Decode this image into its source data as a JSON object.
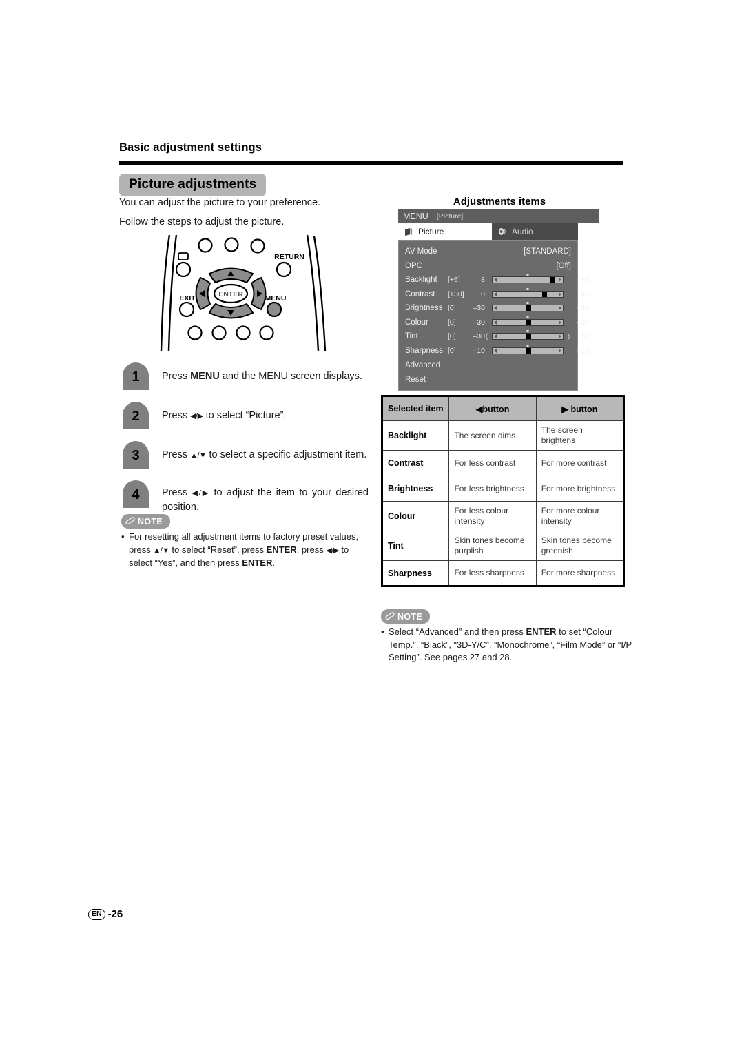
{
  "header": {
    "section_title": "Basic adjustment settings",
    "chapter_title": "Picture adjustments",
    "intro_1": "You can adjust the picture to your preference.",
    "intro_2": "Follow the steps to adjust the picture."
  },
  "remote": {
    "labels": {
      "return": "RETURN",
      "exit": "EXIT",
      "menu": "MENU",
      "enter": "ENTER",
      "up": "▲",
      "down": "▼",
      "left": "◀",
      "right": "▶"
    }
  },
  "steps": [
    {
      "number": "1",
      "text_html": "Press <b class=\"k\">MENU</b> and the MENU screen displays."
    },
    {
      "number": "2",
      "text_html": "Press <span class=\"arrows\">◀/▶</span> to select “Picture”."
    },
    {
      "number": "3",
      "text_html": "Press <span class=\"arrows\">▲/▼</span> to select a specific adjustment item."
    },
    {
      "number": "4",
      "text_html": "Press <span class=\"arrows\">◀/▶</span> to adjust the item to your desired position."
    }
  ],
  "note_left": {
    "badge": "NOTE",
    "icon": "pencil-icon",
    "text_html": "For resetting all adjustment items to factory preset values, press <span class=\"arrows\">▲/▼</span> to select “Reset”, press <b class=\"k\">ENTER</b>, press <span class=\"arrows\">◀/▶</span> to select “Yes”, and then press <b class=\"k\">ENTER</b>."
  },
  "note_right": {
    "badge": "NOTE",
    "icon": "pencil-icon",
    "text_html": "Select “Advanced” and then press <b class=\"k\">ENTER</b> to set “Colour Temp.”, “Black”, “3D-Y/C”, “Monochrome”, “Film Mode” or “I/P Setting”. See pages 27 and 28."
  },
  "osd": {
    "caption": "Adjustments items",
    "titlebar_main": "MENU",
    "titlebar_sub": "[Picture]",
    "tabs": [
      {
        "label": "Picture",
        "icon": "picture-icon",
        "active": true
      },
      {
        "label": "Audio",
        "icon": "speaker-icon",
        "active": false
      }
    ],
    "rows": [
      {
        "type": "value",
        "name": "AV Mode",
        "value": "[STANDARD]"
      },
      {
        "type": "value",
        "name": "OPC",
        "value": "[Off]"
      },
      {
        "type": "slider",
        "name": "Backlight",
        "current": "[+6]",
        "min": "–8",
        "max": "+8",
        "knob_pct": 87.5,
        "brackets": false
      },
      {
        "type": "slider",
        "name": "Contrast",
        "current": "[+30]",
        "min": "0",
        "max": "+40",
        "knob_pct": 75.0,
        "brackets": false
      },
      {
        "type": "slider",
        "name": "Brightness",
        "current": "[0]",
        "min": "–30",
        "max": "+30",
        "knob_pct": 50.0,
        "brackets": false
      },
      {
        "type": "slider",
        "name": "Colour",
        "current": "[0]",
        "min": "–30",
        "max": "+30",
        "knob_pct": 50.0,
        "brackets": false
      },
      {
        "type": "slider",
        "name": "Tint",
        "current": "[0]",
        "min": "–30",
        "max": "+30",
        "knob_pct": 50.0,
        "brackets": true
      },
      {
        "type": "slider",
        "name": "Sharpness",
        "current": "[0]",
        "min": "–10",
        "max": "+10",
        "knob_pct": 50.0,
        "brackets": false
      },
      {
        "type": "plain",
        "name": "Advanced"
      },
      {
        "type": "plain",
        "name": "Reset"
      }
    ]
  },
  "table": {
    "headers": [
      "Selected item",
      "◀button",
      "▶ button"
    ],
    "rows": [
      {
        "item": "Backlight",
        "left": "The screen dims",
        "right": "The screen brightens"
      },
      {
        "item": "Contrast",
        "left": "For less contrast",
        "right": "For more contrast"
      },
      {
        "item": "Brightness",
        "left": "For less brightness",
        "right": "For more brightness"
      },
      {
        "item": "Colour",
        "left": "For less colour intensity",
        "right": "For more colour intensity"
      },
      {
        "item": "Tint",
        "left": "Skin tones become purplish",
        "right": "Skin tones become greenish"
      },
      {
        "item": "Sharpness",
        "left": "For less sharpness",
        "right": "For more sharpness"
      }
    ]
  },
  "footer": {
    "lang": "EN",
    "page": "-26"
  },
  "colors": {
    "rule": "#000000",
    "chapter_bg": "#b3b3b3",
    "badge_gray": "#808080",
    "note_gray": "#9a9a9a",
    "osd_titlebar": "#5e5e5e",
    "osd_body": "#6b6b6b",
    "table_header": "#b8b8b8"
  }
}
